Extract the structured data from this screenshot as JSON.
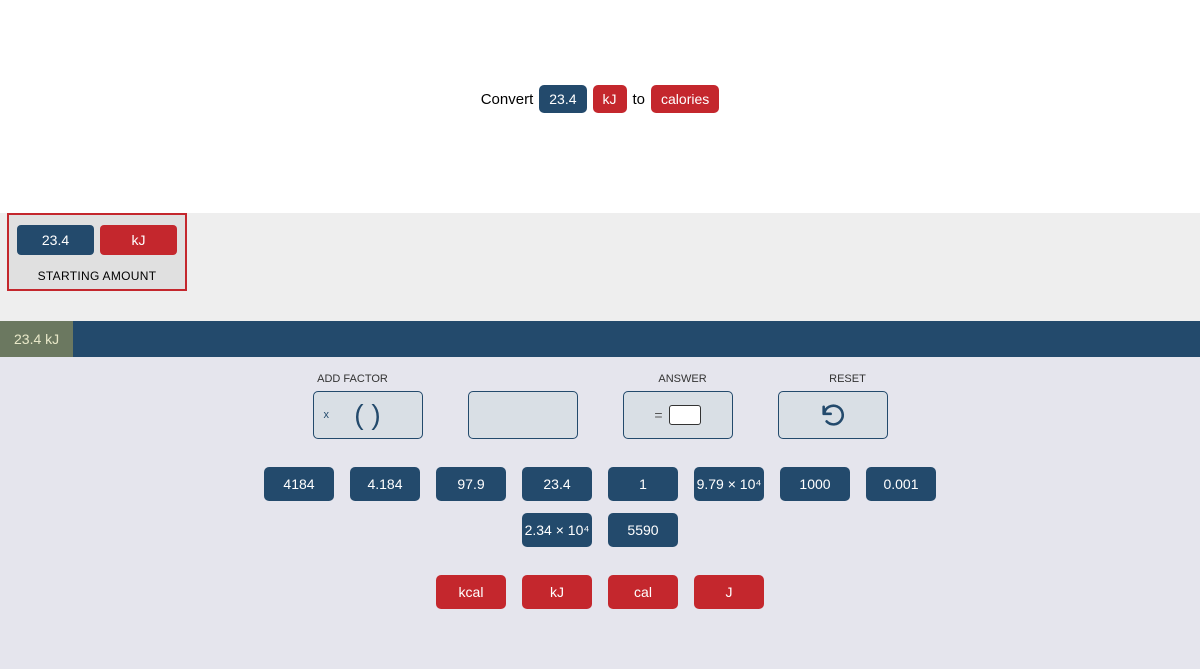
{
  "prompt": {
    "prefix": "Convert",
    "value": "23.4",
    "unit": "kJ",
    "to": "to",
    "target": "calories"
  },
  "starting": {
    "value": "23.4",
    "unit": "kJ",
    "label": "STARTING AMOUNT"
  },
  "result": "23.4 kJ",
  "labels": {
    "add_factor": "ADD FACTOR",
    "answer": "ANSWER",
    "reset": "RESET"
  },
  "factor_box": {
    "x": "x",
    "parens": "(   )"
  },
  "answer_box": {
    "eq": "="
  },
  "numbers_row1": [
    "4184",
    "4.184",
    "97.9",
    "23.4",
    "1",
    "9.79 × 10⁴",
    "1000",
    "0.001"
  ],
  "numbers_row2": [
    "2.34 × 10⁴",
    "5590"
  ],
  "units": [
    "kcal",
    "kJ",
    "cal",
    "J"
  ]
}
